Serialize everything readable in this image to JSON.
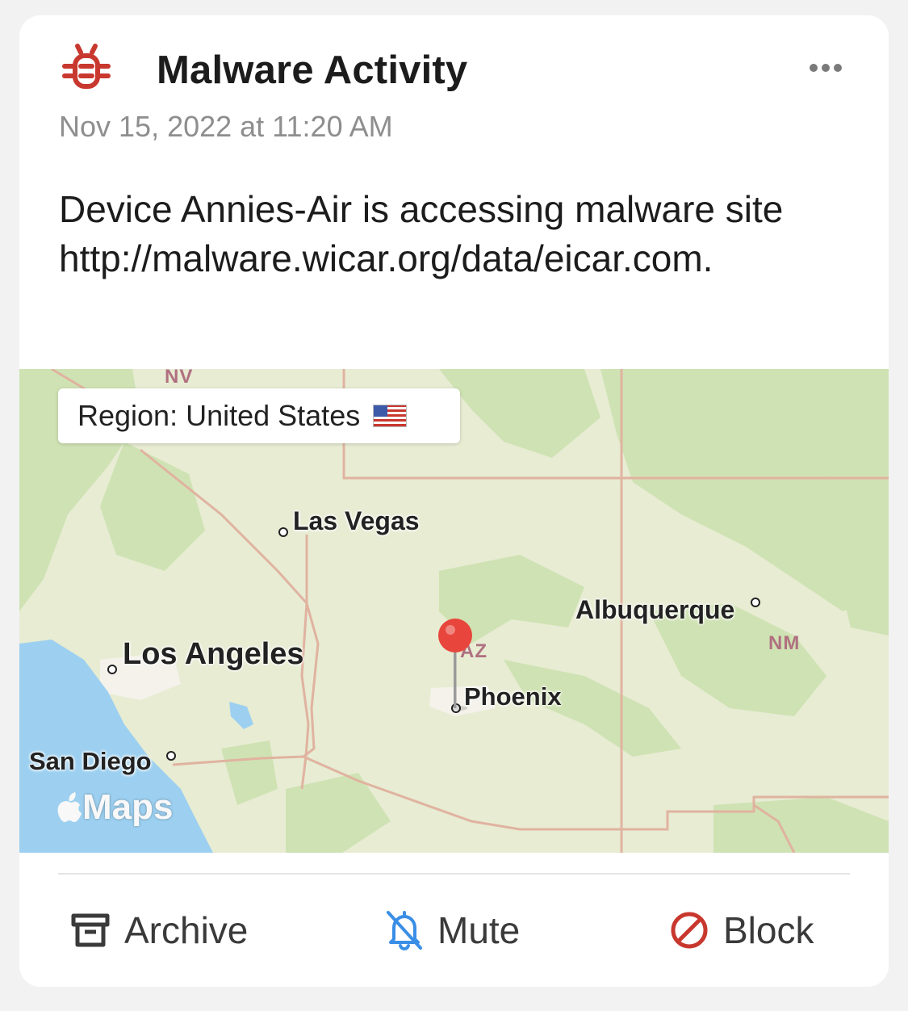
{
  "alert": {
    "title": "Malware Activity",
    "timestamp": "Nov 15, 2022 at 11:20 AM",
    "message": "Device Annies-Air is accessing malware site http://malware.wicar.org/data/eicar.com.",
    "icon": "bug-icon",
    "accent_color": "#c8382e"
  },
  "map": {
    "region_label": "Region: United States",
    "flag": "us-flag-icon",
    "attribution": "Maps",
    "cities": {
      "las_vegas": "Las Vegas",
      "los_angeles": "Los Angeles",
      "san_diego": "San Diego",
      "phoenix": "Phoenix",
      "albuquerque": "Albuquerque"
    },
    "states": {
      "nv": "NV",
      "az": "AZ",
      "nm": "NM"
    },
    "colors": {
      "land": "#e7ecd3",
      "forest": "#cfe2b3",
      "water": "#9dd0f0",
      "border": "#e0b3a0",
      "pin": "#e8453c"
    }
  },
  "actions": {
    "archive": "Archive",
    "mute": "Mute",
    "block": "Block",
    "mute_color": "#3a8ee6",
    "block_color": "#c8382e"
  }
}
